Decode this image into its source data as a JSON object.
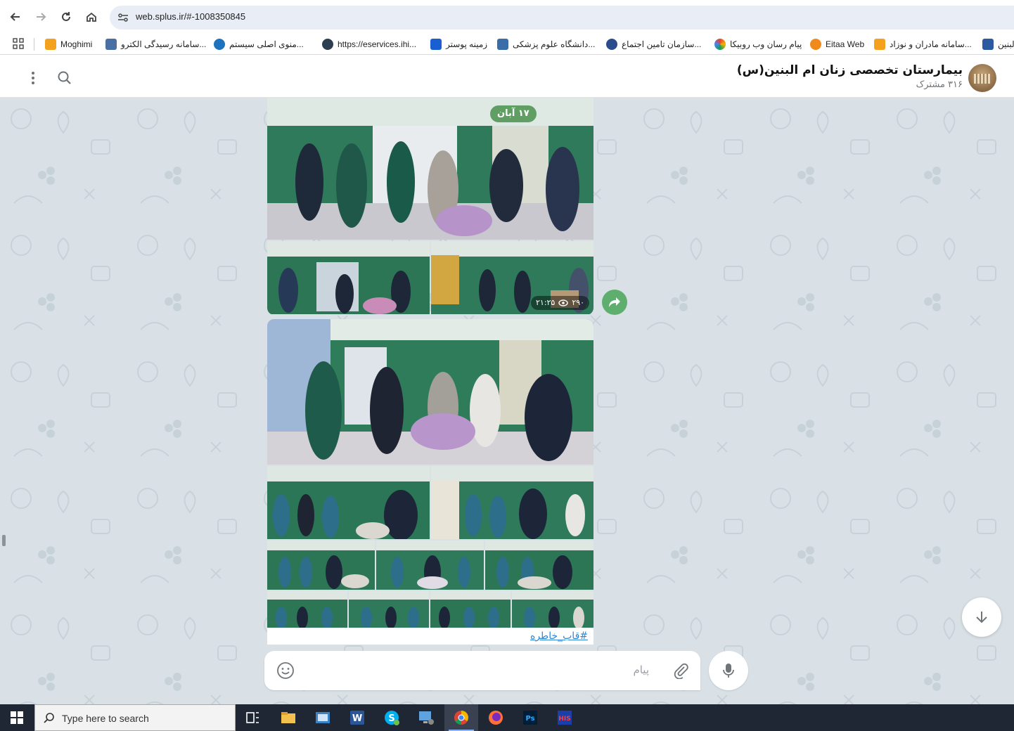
{
  "browser": {
    "url": "web.splus.ir/#-1008350845",
    "bookmarks": [
      {
        "label": "Moghimi",
        "color": "#f4a21d"
      },
      {
        "label": "سامانه رسیدگی الکترو...",
        "color": "#4a6fa5"
      },
      {
        "label": "منوی اصلی سیستم...",
        "color": "#1e73be"
      },
      {
        "label": "https://eservices.ihi...",
        "color": "#2c3e50"
      },
      {
        "label": "زمینه پوستر",
        "color": "#1a5fd1"
      },
      {
        "label": "دانشگاه علوم پزشکی...",
        "color": "#3b6ea8"
      },
      {
        "label": "سازمان تامین اجتماع...",
        "color": "#2b4c8c"
      },
      {
        "label": "پیام رسان وب روبیکا",
        "color": "#e9432b"
      },
      {
        "label": "Eitaa Web",
        "color": "#f08a1c"
      },
      {
        "label": "سامانه مادران و نوزاد...",
        "color": "#f4a21d"
      },
      {
        "label": "لبنین",
        "color": "#2c5aa0"
      }
    ]
  },
  "channel": {
    "title": "بیمارستان تخصصی زنان ام البنین(س)",
    "subscribers": "۳۱۶ مشترک"
  },
  "messages": {
    "album1": {
      "date_pill": "۱۷ آبان",
      "time": "۲۱:۲۵",
      "views": "۲۹۰"
    },
    "album2": {
      "caption": "#قاب_خاطره"
    }
  },
  "composer": {
    "placeholder": "پیام"
  },
  "taskbar": {
    "search_placeholder": "Type here to search",
    "icons": [
      "task-view",
      "file-explorer",
      "control-panel",
      "word",
      "skype",
      "remote-desktop",
      "chrome",
      "firefox",
      "photoshop",
      "his"
    ]
  }
}
